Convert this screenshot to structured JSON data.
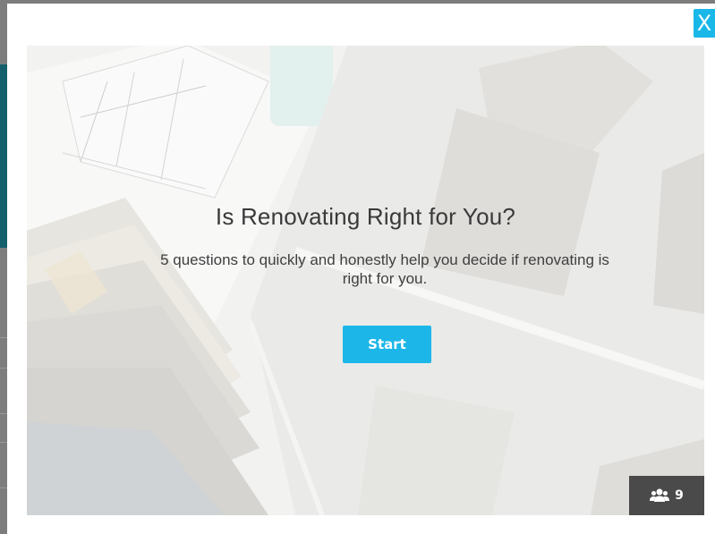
{
  "modal": {
    "close_label": "X"
  },
  "quiz": {
    "title": "Is Renovating Right for You?",
    "subtitle": "5 questions to quickly and honestly help you decide if renovating is right for you.",
    "start_label": "Start"
  },
  "badge": {
    "icon": "users-icon",
    "count": "9"
  },
  "colors": {
    "accent": "#1cb7e8",
    "badge_bg": "#4a4a4a",
    "title_text": "#3a3a3a"
  }
}
